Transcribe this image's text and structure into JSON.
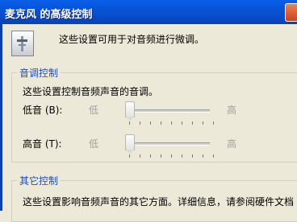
{
  "window": {
    "title": "麦克风 的高级控制"
  },
  "intro": {
    "text": "这些设置可用于对音频进行微调。"
  },
  "tone": {
    "group_label": "音调控制",
    "description": "这些设置控制音频声音的音调。",
    "bass": {
      "label": "低音 (B):",
      "low": "低",
      "high": "高",
      "value_fraction": 0.0
    },
    "treble": {
      "label": "高音 (T):",
      "low": "低",
      "high": "高",
      "value_fraction": 0.0
    }
  },
  "other": {
    "group_label": "其它控制",
    "description": "这些设置影响音频声音的其它方面。详细信息，请参阅硬件文档"
  }
}
